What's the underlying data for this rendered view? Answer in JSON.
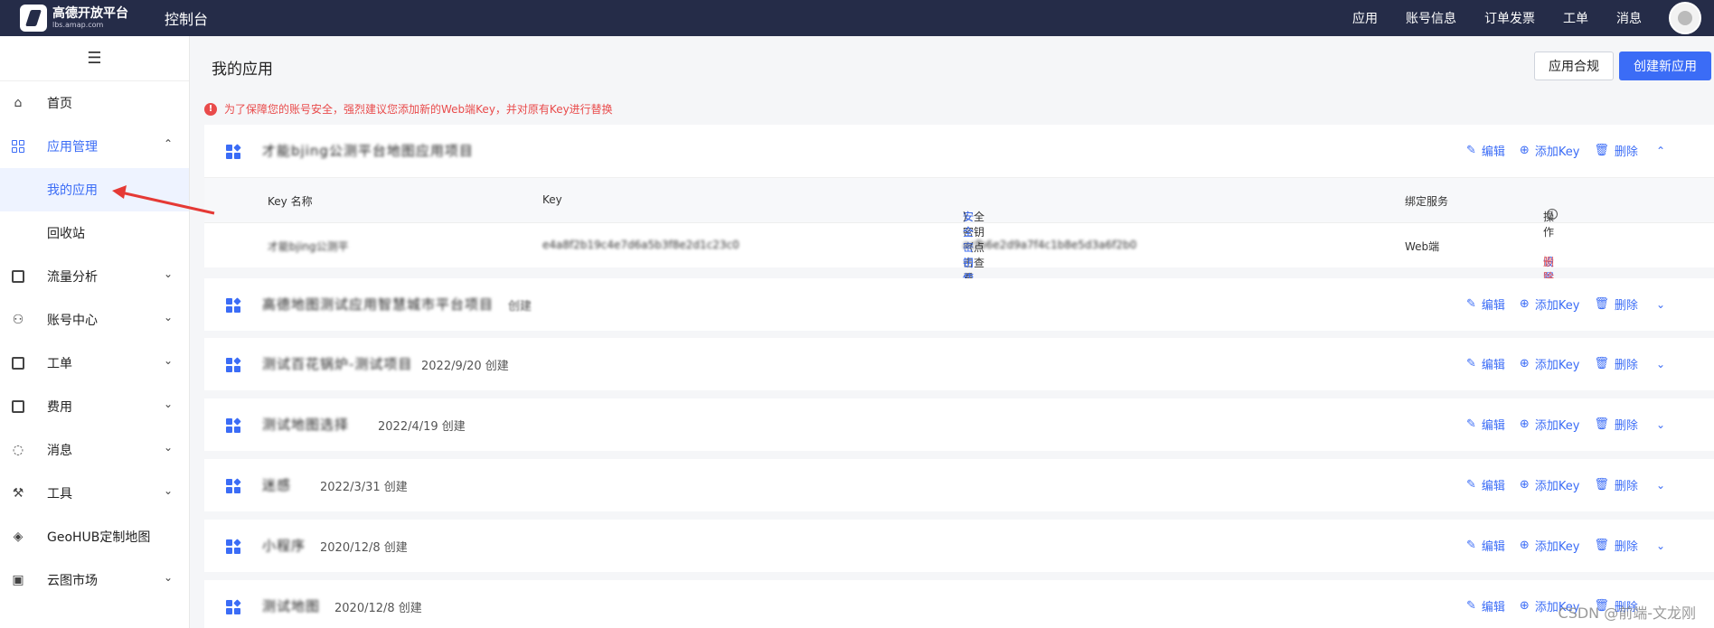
{
  "topbar": {
    "logo_name": "高德开放平台",
    "logo_domain": "lbs.amap.com",
    "console": "控制台",
    "nav": [
      "应用",
      "账号信息",
      "订单发票",
      "工单",
      "消息"
    ]
  },
  "sidebar": {
    "collapse_icon": "menu-icon",
    "items": [
      {
        "label": "首页",
        "icon": "home-icon"
      },
      {
        "label": "应用管理",
        "icon": "apps-icon",
        "expanded": true,
        "children": [
          {
            "label": "我的应用",
            "active": true
          },
          {
            "label": "回收站"
          }
        ]
      },
      {
        "label": "流量分析",
        "icon": "chart-icon"
      },
      {
        "label": "账号中心",
        "icon": "user-icon"
      },
      {
        "label": "工单",
        "icon": "ticket-icon"
      },
      {
        "label": "费用",
        "icon": "fee-icon"
      },
      {
        "label": "消息",
        "icon": "message-icon"
      },
      {
        "label": "工具",
        "icon": "tool-icon"
      },
      {
        "label": "GeoHUB定制地图",
        "icon": "layers-icon"
      },
      {
        "label": "云图市场",
        "icon": "store-icon"
      }
    ]
  },
  "main": {
    "title": "我的应用",
    "btn_compliance": "应用合规",
    "btn_create": "创建新应用",
    "warning": "为了保障您的账号安全，强烈建议您添加新的Web端Key，并对原有Key进行替换",
    "actions": {
      "edit": "编辑",
      "add_key": "添加Key",
      "delete": "删除"
    },
    "key_table": {
      "headers": [
        "Key 名称",
        "Key",
        "安全密钥（点击查看",
        "安全密钥使用说明",
        "）",
        "绑定服务",
        "操作"
      ],
      "rows": [
        {
          "name": "才能bjing公测平",
          "key": "e4a8f2b19c4e7d6a5b3f8e2d1c23c0",
          "secret": "acfb6e2d9a7f4c1b8e5d3a6f2b0",
          "service": "Web端",
          "op_set": "设置",
          "op_delete": "删除"
        }
      ]
    },
    "apps": [
      {
        "name": "才能bjing公测平台地图应用项目",
        "date": ""
      },
      {
        "name": "高德地图测试应用智慧城市平台项目",
        "date": "创建"
      },
      {
        "name": "测试百花锅炉-测试项目",
        "date": "2022/9/20 创建"
      },
      {
        "name": "测试地图选择",
        "date": "2022/4/19 创建"
      },
      {
        "name": "迷感",
        "date": "2022/3/31 创建"
      },
      {
        "name": "小程序",
        "date": "2020/12/8 创建"
      },
      {
        "name": "测试地图",
        "date": "2020/12/8 创建"
      }
    ]
  },
  "watermark": "CSDN @前端-文龙刚"
}
